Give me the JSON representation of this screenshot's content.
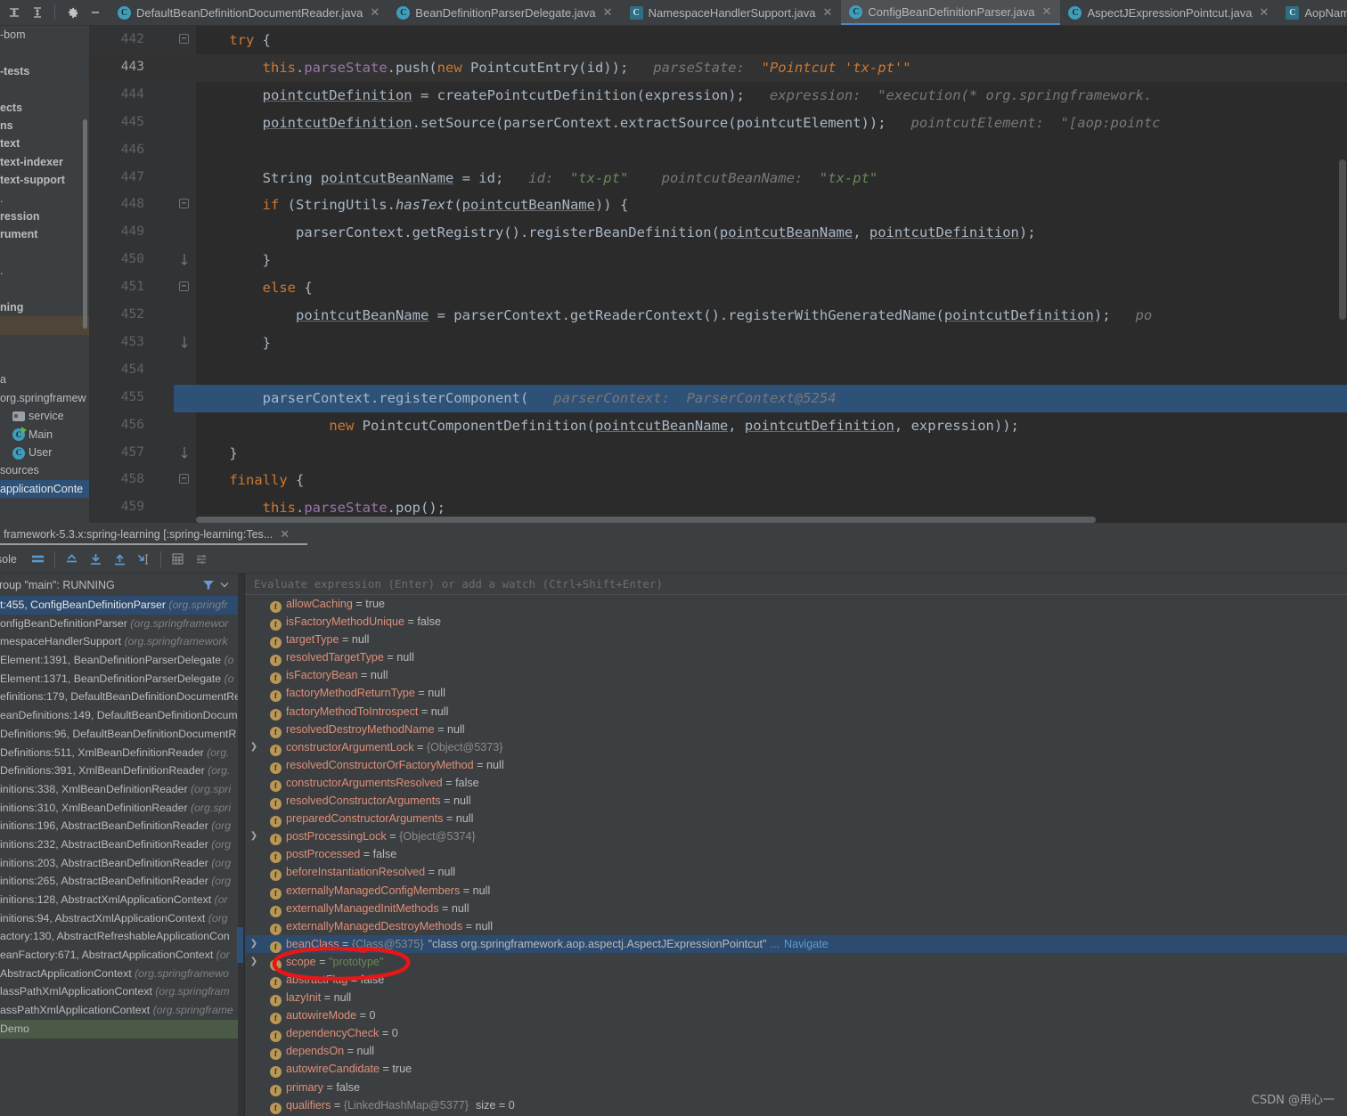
{
  "window": {
    "toolbar_icons": [
      "collapse-all-icon",
      "expand-all-icon",
      "settings-gear-icon",
      "minimize-icon"
    ]
  },
  "tabs": [
    {
      "label": "DefaultBeanDefinitionDocumentReader.java",
      "icon": "java-class-icon",
      "active": false
    },
    {
      "label": "BeanDefinitionParserDelegate.java",
      "icon": "java-class-icon",
      "active": false
    },
    {
      "label": "NamespaceHandlerSupport.java",
      "icon": "java-interface-icon",
      "active": false
    },
    {
      "label": "ConfigBeanDefinitionParser.java",
      "icon": "java-class-icon",
      "active": true
    },
    {
      "label": "AspectJExpressionPointcut.java",
      "icon": "java-class-icon",
      "active": false
    },
    {
      "label": "AopNamespaceUtils.ja",
      "icon": "java-interface-icon",
      "active": false
    }
  ],
  "project_tree": [
    {
      "label": "-bom",
      "indent": 0,
      "bold": false,
      "icon": "none"
    },
    {
      "label": "",
      "indent": 0,
      "bold": false,
      "icon": "none"
    },
    {
      "label": "-tests",
      "indent": 0,
      "bold": true,
      "icon": "none"
    },
    {
      "label": "",
      "indent": 0,
      "bold": false,
      "icon": "none"
    },
    {
      "label": "ects",
      "indent": 0,
      "bold": true,
      "icon": "none"
    },
    {
      "label": "ns",
      "indent": 0,
      "bold": true,
      "icon": "none"
    },
    {
      "label": "text",
      "indent": 0,
      "bold": true,
      "icon": "none"
    },
    {
      "label": "text-indexer",
      "indent": 0,
      "bold": true,
      "icon": "none"
    },
    {
      "label": "text-support",
      "indent": 0,
      "bold": true,
      "icon": "none"
    },
    {
      "label": ".",
      "indent": 0,
      "bold": false,
      "icon": "none"
    },
    {
      "label": "ression",
      "indent": 0,
      "bold": true,
      "icon": "none"
    },
    {
      "label": "rument",
      "indent": 0,
      "bold": true,
      "icon": "none"
    },
    {
      "label": "",
      "indent": 0,
      "bold": false,
      "icon": "none"
    },
    {
      "label": ".",
      "indent": 0,
      "bold": false,
      "icon": "none"
    },
    {
      "label": "",
      "indent": 0,
      "bold": false,
      "icon": "none"
    },
    {
      "label": "ning",
      "indent": 0,
      "bold": true,
      "icon": "none"
    },
    {
      "label": "",
      "indent": 0,
      "bold": false,
      "icon": "none",
      "highlight": "brown"
    },
    {
      "label": "",
      "indent": 0,
      "bold": false,
      "icon": "none"
    },
    {
      "label": "",
      "indent": 0,
      "bold": false,
      "icon": "none"
    },
    {
      "label": "a",
      "indent": 0,
      "bold": false,
      "icon": "none"
    },
    {
      "label": "org.springframew",
      "indent": 0,
      "bold": false,
      "icon": "none"
    },
    {
      "label": "service",
      "indent": 1,
      "bold": false,
      "icon": "folder"
    },
    {
      "label": "Main",
      "indent": 1,
      "bold": false,
      "icon": "class-run"
    },
    {
      "label": "User",
      "indent": 1,
      "bold": false,
      "icon": "class"
    },
    {
      "label": "sources",
      "indent": 0,
      "bold": false,
      "icon": "none"
    },
    {
      "label": "applicationConte",
      "indent": 0,
      "bold": false,
      "icon": "none",
      "highlight": "blue"
    }
  ],
  "editor": {
    "lines": [
      {
        "num": "442",
        "current": false,
        "fold": "minus",
        "tokens": [
          {
            "t": "    ",
            "c": "plain"
          },
          {
            "t": "try",
            "c": "kw"
          },
          {
            "t": " {",
            "c": "plain"
          }
        ]
      },
      {
        "num": "443",
        "current": true,
        "fold": "",
        "tokens": [
          {
            "t": "        ",
            "c": "plain"
          },
          {
            "t": "this",
            "c": "kw"
          },
          {
            "t": ".",
            "c": "plain"
          },
          {
            "t": "parseState",
            "c": "fld"
          },
          {
            "t": ".push(",
            "c": "plain"
          },
          {
            "t": "new",
            "c": "kw"
          },
          {
            "t": " PointcutEntry(id));",
            "c": "plain"
          },
          {
            "t": "   parseState:  ",
            "c": "hint"
          },
          {
            "t": "\"Pointcut 'tx-pt'\"",
            "c": "hint-orange"
          }
        ]
      },
      {
        "num": "444",
        "current": false,
        "fold": "",
        "tokens": [
          {
            "t": "        ",
            "c": "plain"
          },
          {
            "t": "pointcutDefinition",
            "c": "und"
          },
          {
            "t": " = createPointcutDefinition(expression);",
            "c": "plain"
          },
          {
            "t": "   expression:  \"execution(* org.springframework.",
            "c": "hint"
          }
        ]
      },
      {
        "num": "445",
        "current": false,
        "fold": "",
        "tokens": [
          {
            "t": "        ",
            "c": "plain"
          },
          {
            "t": "pointcutDefinition",
            "c": "und"
          },
          {
            "t": ".setSource(parserContext.extractSource(pointcutElement));",
            "c": "plain"
          },
          {
            "t": "   pointcutElement:  \"[aop:pointc",
            "c": "hint"
          }
        ]
      },
      {
        "num": "446",
        "current": false,
        "fold": "",
        "tokens": []
      },
      {
        "num": "447",
        "current": false,
        "fold": "",
        "tokens": [
          {
            "t": "        ",
            "c": "plain"
          },
          {
            "t": "String ",
            "c": "plain"
          },
          {
            "t": "pointcutBeanName",
            "c": "und"
          },
          {
            "t": " = id;",
            "c": "plain"
          },
          {
            "t": "   id:  ",
            "c": "hint"
          },
          {
            "t": "\"tx-pt\"",
            "c": "hint-str"
          },
          {
            "t": "    pointcutBeanName:  ",
            "c": "hint"
          },
          {
            "t": "\"tx-pt\"",
            "c": "hint-str"
          }
        ]
      },
      {
        "num": "448",
        "current": false,
        "fold": "minus",
        "tokens": [
          {
            "t": "        ",
            "c": "plain"
          },
          {
            "t": "if",
            "c": "kw"
          },
          {
            "t": " (StringUtils.",
            "c": "plain"
          },
          {
            "t": "hasText",
            "c": "ital"
          },
          {
            "t": "(",
            "c": "plain"
          },
          {
            "t": "pointcutBeanName",
            "c": "und"
          },
          {
            "t": ")) {",
            "c": "plain"
          }
        ]
      },
      {
        "num": "449",
        "current": false,
        "fold": "",
        "tokens": [
          {
            "t": "            parserContext.getRegistry().registerBeanDefinition(",
            "c": "plain"
          },
          {
            "t": "pointcutBeanName",
            "c": "und"
          },
          {
            "t": ", ",
            "c": "plain"
          },
          {
            "t": "pointcutDefinition",
            "c": "und"
          },
          {
            "t": ");",
            "c": "plain"
          }
        ]
      },
      {
        "num": "450",
        "current": false,
        "fold": "end",
        "tokens": [
          {
            "t": "        }",
            "c": "plain"
          }
        ]
      },
      {
        "num": "451",
        "current": false,
        "fold": "minus2",
        "tokens": [
          {
            "t": "        ",
            "c": "plain"
          },
          {
            "t": "else",
            "c": "kw"
          },
          {
            "t": " {",
            "c": "plain"
          }
        ]
      },
      {
        "num": "452",
        "current": false,
        "fold": "",
        "tokens": [
          {
            "t": "            ",
            "c": "plain"
          },
          {
            "t": "pointcutBeanName",
            "c": "und"
          },
          {
            "t": " = parserContext.getReaderContext().registerWithGeneratedName(",
            "c": "plain"
          },
          {
            "t": "pointcutDefinition",
            "c": "und"
          },
          {
            "t": ");",
            "c": "plain"
          },
          {
            "t": "   po",
            "c": "hint"
          }
        ]
      },
      {
        "num": "453",
        "current": false,
        "fold": "end",
        "tokens": [
          {
            "t": "        }",
            "c": "plain"
          }
        ]
      },
      {
        "num": "454",
        "current": false,
        "fold": "",
        "tokens": []
      },
      {
        "num": "455",
        "current": false,
        "executing": true,
        "fold": "",
        "tokens": [
          {
            "t": "        parserContext.registerComponent(",
            "c": "plain"
          },
          {
            "t": "   parserContext:  ParserContext@5254",
            "c": "hint"
          }
        ]
      },
      {
        "num": "456",
        "current": false,
        "fold": "",
        "tokens": [
          {
            "t": "                ",
            "c": "plain"
          },
          {
            "t": "new",
            "c": "kw"
          },
          {
            "t": " PointcutComponentDefinition(",
            "c": "plain"
          },
          {
            "t": "pointcutBeanName",
            "c": "und"
          },
          {
            "t": ", ",
            "c": "plain"
          },
          {
            "t": "pointcutDefinition",
            "c": "und"
          },
          {
            "t": ", expression));",
            "c": "plain"
          }
        ]
      },
      {
        "num": "457",
        "current": false,
        "fold": "end",
        "tokens": [
          {
            "t": "    }",
            "c": "plain"
          }
        ]
      },
      {
        "num": "458",
        "current": false,
        "fold": "minus2",
        "tokens": [
          {
            "t": "    ",
            "c": "plain"
          },
          {
            "t": "finally",
            "c": "kw"
          },
          {
            "t": " {",
            "c": "plain"
          }
        ]
      },
      {
        "num": "459",
        "current": false,
        "fold": "",
        "tokens": [
          {
            "t": "        ",
            "c": "plain"
          },
          {
            "t": "this",
            "c": "kw"
          },
          {
            "t": ".",
            "c": "plain"
          },
          {
            "t": "parseState",
            "c": "fld"
          },
          {
            "t": ".pop();",
            "c": "plain"
          }
        ]
      }
    ]
  },
  "run_tab": {
    "label": "framework-5.3.x:spring-learning [:spring-learning:Tes...",
    "close_icon": "close-icon"
  },
  "debug_toolbar": {
    "console_label": "onsole",
    "icons": [
      "frames-icon",
      "step-out-icon",
      "step-into-icon",
      "step-over-icon",
      "force-step-into-icon",
      "evaluate-icon",
      "settings-list-icon"
    ]
  },
  "frames_panel": {
    "thread_label": "group \"main\": RUNNING",
    "filter_icon": "filter-icon",
    "dropdown_icon": "chevron-down-icon",
    "rows": [
      {
        "text": "t:455, ConfigBeanDefinitionParser ",
        "pkg": "(org.springfr",
        "state": "selected"
      },
      {
        "text": "onfigBeanDefinitionParser ",
        "pkg": "(org.springframewor",
        "state": "normal"
      },
      {
        "text": "mespaceHandlerSupport ",
        "pkg": "(org.springframework",
        "state": "normal"
      },
      {
        "text": "Element:1391, BeanDefinitionParserDelegate ",
        "pkg": "(o",
        "state": "normal"
      },
      {
        "text": "Element:1371, BeanDefinitionParserDelegate ",
        "pkg": "(o",
        "state": "normal"
      },
      {
        "text": "efinitions:179, DefaultBeanDefinitionDocumentRe",
        "pkg": "",
        "state": "normal"
      },
      {
        "text": "eanDefinitions:149, DefaultBeanDefinitionDocum",
        "pkg": "",
        "state": "normal"
      },
      {
        "text": "Definitions:96, DefaultBeanDefinitionDocumentR",
        "pkg": "",
        "state": "normal"
      },
      {
        "text": "Definitions:511, XmlBeanDefinitionReader ",
        "pkg": "(org.",
        "state": "normal"
      },
      {
        "text": "Definitions:391, XmlBeanDefinitionReader ",
        "pkg": "(org.",
        "state": "normal"
      },
      {
        "text": "initions:338, XmlBeanDefinitionReader ",
        "pkg": "(org.spri",
        "state": "normal"
      },
      {
        "text": "initions:310, XmlBeanDefinitionReader ",
        "pkg": "(org.spri",
        "state": "normal"
      },
      {
        "text": "initions:196, AbstractBeanDefinitionReader ",
        "pkg": "(org",
        "state": "normal"
      },
      {
        "text": "initions:232, AbstractBeanDefinitionReader ",
        "pkg": "(org",
        "state": "normal"
      },
      {
        "text": "initions:203, AbstractBeanDefinitionReader ",
        "pkg": "(org",
        "state": "normal"
      },
      {
        "text": "initions:265, AbstractBeanDefinitionReader ",
        "pkg": "(org",
        "state": "normal"
      },
      {
        "text": "initions:128, AbstractXmlApplicationContext ",
        "pkg": "(or",
        "state": "normal"
      },
      {
        "text": "initions:94, AbstractXmlApplicationContext ",
        "pkg": "(org",
        "state": "normal"
      },
      {
        "text": "actory:130, AbstractRefreshableApplicationCon",
        "pkg": "",
        "state": "normal"
      },
      {
        "text": "eanFactory:671, AbstractApplicationContext ",
        "pkg": "(or",
        "state": "normal"
      },
      {
        "text": "AbstractApplicationContext ",
        "pkg": "(org.springframewo",
        "state": "normal"
      },
      {
        "text": "lassPathXmlApplicationContext ",
        "pkg": "(org.springfram",
        "state": "normal"
      },
      {
        "text": "assPathXmlApplicationContext ",
        "pkg": "(org.springframe",
        "state": "normal"
      },
      {
        "text": "Demo",
        "pkg": "",
        "state": "green"
      }
    ]
  },
  "variables_panel": {
    "evaluate_placeholder": "Evaluate expression (Enter) or add a watch (Ctrl+Shift+Enter)",
    "rows": [
      {
        "expand": false,
        "name": "allowCaching",
        "value": "true",
        "vtype": "plain"
      },
      {
        "expand": false,
        "name": "isFactoryMethodUnique",
        "value": "false",
        "vtype": "plain"
      },
      {
        "expand": false,
        "name": "targetType",
        "value": "null",
        "vtype": "plain"
      },
      {
        "expand": false,
        "name": "resolvedTargetType",
        "value": "null",
        "vtype": "plain"
      },
      {
        "expand": false,
        "name": "isFactoryBean",
        "value": "null",
        "vtype": "plain"
      },
      {
        "expand": false,
        "name": "factoryMethodReturnType",
        "value": "null",
        "vtype": "plain"
      },
      {
        "expand": false,
        "name": "factoryMethodToIntrospect",
        "value": "null",
        "vtype": "plain"
      },
      {
        "expand": false,
        "name": "resolvedDestroyMethodName",
        "value": "null",
        "vtype": "plain"
      },
      {
        "expand": true,
        "name": "constructorArgumentLock",
        "value": "{Object@5373}",
        "vtype": "ref"
      },
      {
        "expand": false,
        "name": "resolvedConstructorOrFactoryMethod",
        "value": "null",
        "vtype": "plain"
      },
      {
        "expand": false,
        "name": "constructorArgumentsResolved",
        "value": "false",
        "vtype": "plain"
      },
      {
        "expand": false,
        "name": "resolvedConstructorArguments",
        "value": "null",
        "vtype": "plain"
      },
      {
        "expand": false,
        "name": "preparedConstructorArguments",
        "value": "null",
        "vtype": "plain"
      },
      {
        "expand": true,
        "name": "postProcessingLock",
        "value": "{Object@5374}",
        "vtype": "ref"
      },
      {
        "expand": false,
        "name": "postProcessed",
        "value": "false",
        "vtype": "plain"
      },
      {
        "expand": false,
        "name": "beforeInstantiationResolved",
        "value": "null",
        "vtype": "plain"
      },
      {
        "expand": false,
        "name": "externallyManagedConfigMembers",
        "value": "null",
        "vtype": "plain"
      },
      {
        "expand": false,
        "name": "externallyManagedInitMethods",
        "value": "null",
        "vtype": "plain"
      },
      {
        "expand": false,
        "name": "externallyManagedDestroyMethods",
        "value": "null",
        "vtype": "plain"
      },
      {
        "expand": true,
        "name": "beanClass",
        "value": "{Class@5375}",
        "vtype": "class",
        "extra": "\"class org.springframework.aop.aspectj.AspectJExpressionPointcut\"",
        "suffix": "...",
        "nav": "Navigate",
        "selected": true
      },
      {
        "expand": true,
        "name": "scope",
        "value": "\"prototype\"",
        "vtype": "str",
        "circled": true
      },
      {
        "expand": false,
        "name": "abstractFlag",
        "value": "false",
        "vtype": "plain"
      },
      {
        "expand": false,
        "name": "lazyInit",
        "value": "null",
        "vtype": "plain"
      },
      {
        "expand": false,
        "name": "autowireMode",
        "value": "0",
        "vtype": "plain"
      },
      {
        "expand": false,
        "name": "dependencyCheck",
        "value": "0",
        "vtype": "plain"
      },
      {
        "expand": false,
        "name": "dependsOn",
        "value": "null",
        "vtype": "plain"
      },
      {
        "expand": false,
        "name": "autowireCandidate",
        "value": "true",
        "vtype": "plain"
      },
      {
        "expand": false,
        "name": "primary",
        "value": "false",
        "vtype": "plain"
      },
      {
        "expand": false,
        "name": "qualifiers",
        "value": "{LinkedHashMap@5377}",
        "vtype": "ref",
        "size": "size = 0"
      }
    ]
  },
  "annotation": {
    "shape": "red-ellipse",
    "color": "#e61717",
    "target": "scope = \"prototype\""
  },
  "watermark": "CSDN @用心一"
}
